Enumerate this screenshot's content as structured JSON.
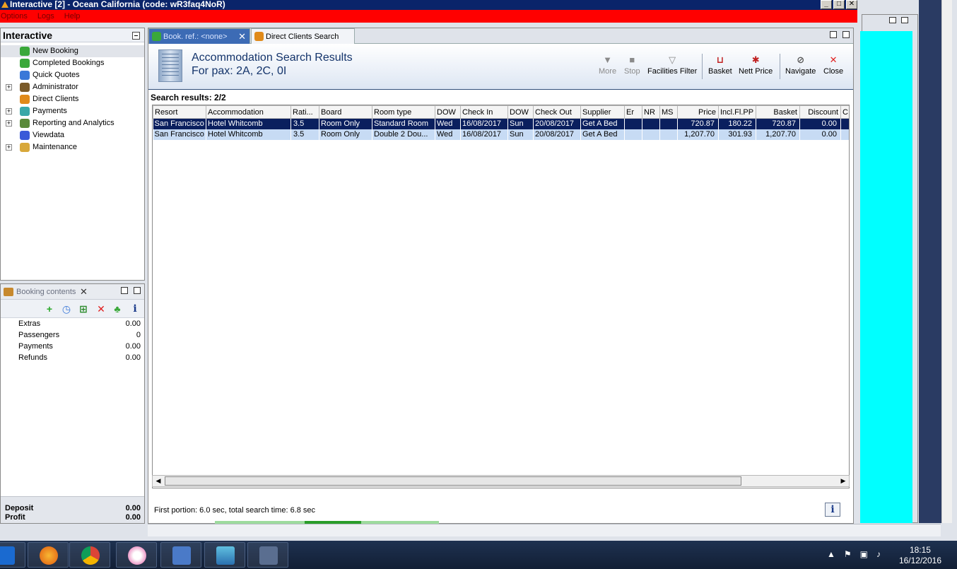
{
  "window": {
    "title": "Interactive [2] - Ocean California (code: wR3faq4NoR)"
  },
  "menu": [
    "Options",
    "Logs",
    "Help"
  ],
  "nav": {
    "title": "Interactive",
    "items": [
      {
        "label": "New Booking",
        "expandable": false,
        "icon": "palm-icon",
        "color": "#3aa83a"
      },
      {
        "label": "Completed Bookings",
        "expandable": false,
        "icon": "palm-icon",
        "color": "#3aa83a"
      },
      {
        "label": "Quick Quotes",
        "expandable": false,
        "icon": "clock-icon",
        "color": "#3a78d8"
      },
      {
        "label": "Administrator",
        "expandable": true,
        "icon": "person-icon",
        "color": "#7a5a2a"
      },
      {
        "label": "Direct Clients",
        "expandable": false,
        "icon": "clients-icon",
        "color": "#e08a1a"
      },
      {
        "label": "Payments",
        "expandable": true,
        "icon": "payments-icon",
        "color": "#3aa8a8"
      },
      {
        "label": "Reporting and Analytics",
        "expandable": true,
        "icon": "report-icon",
        "color": "#5a8a3a"
      },
      {
        "label": "Viewdata",
        "expandable": false,
        "icon": "globe-icon",
        "color": "#3a5ad8"
      },
      {
        "label": "Maintenance",
        "expandable": true,
        "icon": "books-icon",
        "color": "#d8a83a"
      }
    ]
  },
  "booking": {
    "title": "Booking contents",
    "rows": [
      {
        "label": "Extras",
        "value": "0.00"
      },
      {
        "label": "Passengers",
        "value": "0"
      },
      {
        "label": "Payments",
        "value": "0.00"
      },
      {
        "label": "Refunds",
        "value": "0.00"
      }
    ],
    "footer": [
      {
        "label": "Deposit",
        "value": "0.00"
      },
      {
        "label": "Profit",
        "value": "0.00"
      }
    ]
  },
  "tabs": {
    "active": "Book. ref.: <none>",
    "inactive": "Direct Clients Search"
  },
  "results": {
    "title": "Accommodation Search Results",
    "subtitle": "For pax: 2A, 2C, 0I",
    "count_label": "Search results: 2/2",
    "status": "First portion: 6.0 sec, total search time: 6.8 sec",
    "columns": [
      "Resort",
      "Accommodation",
      "Rati...",
      "Board",
      "Room type",
      "DOW",
      "Check In",
      "DOW",
      "Check Out",
      "Supplier",
      "Er",
      "NR",
      "MS",
      "Price",
      "Incl.Fl.PP",
      "Basket",
      "Discount",
      "C"
    ],
    "rows": [
      [
        "San Francisco",
        "Hotel Whitcomb",
        "3.5",
        "Room Only",
        "Standard Room",
        "Wed",
        "16/08/2017",
        "Sun",
        "20/08/2017",
        "Get A Bed",
        "",
        "",
        "",
        "720.87",
        "180.22",
        "720.87",
        "0.00",
        ""
      ],
      [
        "San Francisco",
        "Hotel Whitcomb",
        "3.5",
        "Room Only",
        "Double 2 Dou...",
        "Wed",
        "16/08/2017",
        "Sun",
        "20/08/2017",
        "Get A Bed",
        "",
        "",
        "",
        "1,207.70",
        "301.93",
        "1,207.70",
        "0.00",
        ""
      ]
    ]
  },
  "toolbar": {
    "more": "More",
    "stop": "Stop",
    "facilities": "Facilities Filter",
    "basket": "Basket",
    "nett": "Nett Price",
    "navigate": "Navigate",
    "close": "Close"
  },
  "taskbar": {
    "time": "18:15",
    "date": "16/12/2016"
  }
}
